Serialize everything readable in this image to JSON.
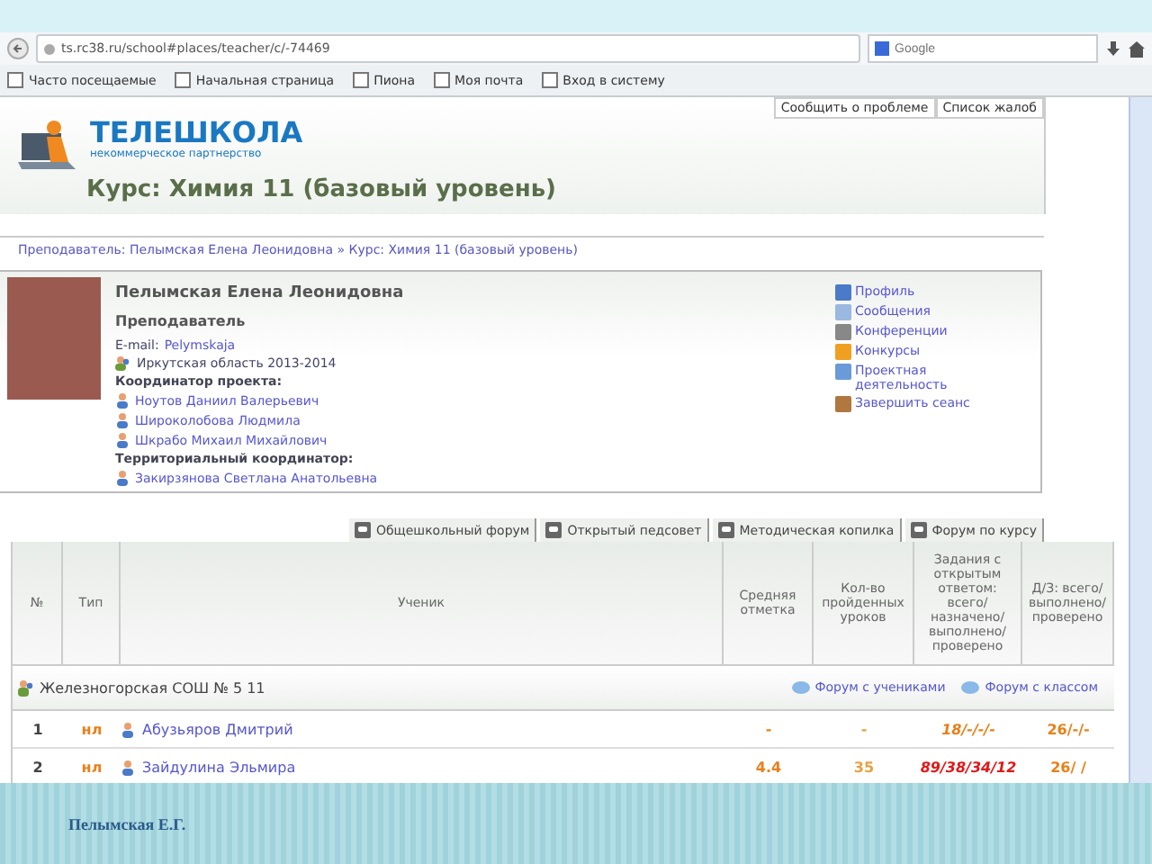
{
  "browser": {
    "url": "ts.rc38.ru/school#places/teacher/c/-74469",
    "search": {
      "placeholder": "Google"
    },
    "bookmarks": [
      "Часто посещаемые",
      "Начальная страница",
      "Пиона",
      "Моя почта",
      "Вход в систему"
    ]
  },
  "top_links": [
    "Сообщить о проблеме",
    "Список жалоб"
  ],
  "logo": {
    "name": "ТЕЛЕШКОЛА",
    "subtitle": "некоммерческое партнерство"
  },
  "course_title": "Курс: Химия 11 (базовый уровень)",
  "breadcrumb": "Преподаватель: Пелымская Елена Леонидовна » Курс: Химия 11 (базовый уровень)",
  "profile": {
    "name": "Пелымская Елена Леонидовна",
    "role": "Преподаватель",
    "email_label": "E-mail:",
    "email": "Pelymskaja",
    "region": "Иркутская область 2013-2014",
    "coordinators_label": "Координатор проекта:",
    "coordinators": [
      "Ноутов Даниил Валерьевич",
      "Широколобова Людмила",
      "Шкрабо Михаил Михайлович"
    ],
    "territorial_label": "Территориальный координатор:",
    "territorial": [
      "Закирзянова Светлана Анатольевна"
    ]
  },
  "menu": [
    "Профиль",
    "Сообщения",
    "Конференции",
    "Конкурсы",
    "Проектная деятельность",
    "Завершить сеанс"
  ],
  "forum_tabs": [
    "Общешкольный форум",
    "Открытый педсовет",
    "Методическая копилка",
    "Форум по курсу"
  ],
  "table": {
    "columns": [
      "№",
      "Тип",
      "Ученик",
      "Средняя отметка",
      "Кол-во пройденных уроков",
      "Задания с открытым ответом: всего/ назначено/ выполнено/ проверено",
      "Д/З: всего/ выполнено/ проверено"
    ],
    "group": {
      "name": "Железногорская СОШ № 5   11",
      "links": [
        "Форум с учениками",
        "Форум с классом"
      ]
    },
    "rows": [
      {
        "num": "1",
        "type": "нл",
        "name": "Абузьяров Дмитрий",
        "avg": "-",
        "lessons": "-",
        "tasks": "18/-/-/-",
        "homework": "26/-/-",
        "overdue": false
      },
      {
        "num": "2",
        "type": "нл",
        "name": "Зайдулина Эльмира",
        "avg": "4.4",
        "lessons": "35",
        "tasks": "89/38/34/12",
        "homework": "26/ /",
        "overdue": true
      }
    ]
  },
  "footer": "Пелымская Е.Г."
}
